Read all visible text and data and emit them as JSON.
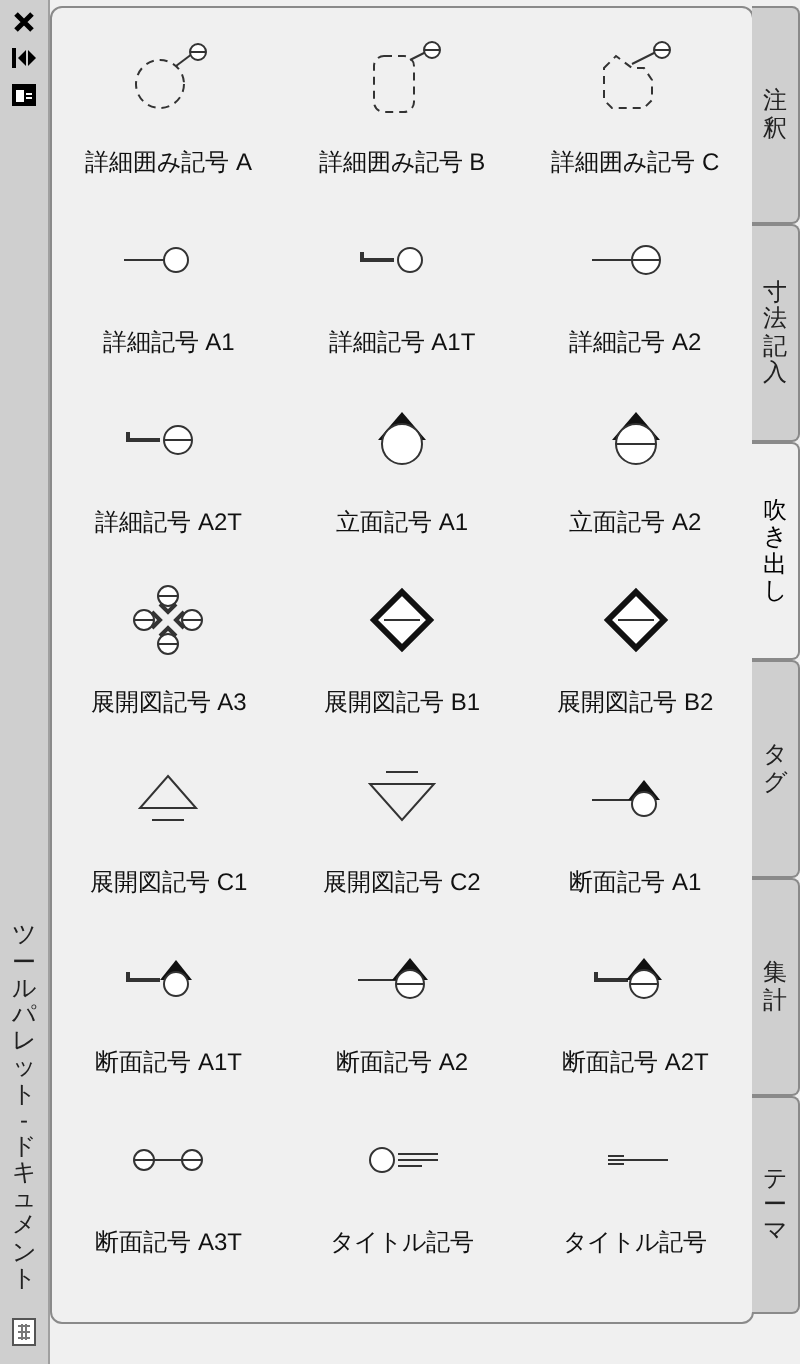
{
  "palette_title": "ツールパレット - ドキュメント",
  "tabs": [
    {
      "label": "注釈",
      "selected": false
    },
    {
      "label": "寸法記入",
      "selected": false
    },
    {
      "label": "吹き出し",
      "selected": true
    },
    {
      "label": "タグ",
      "selected": false
    },
    {
      "label": "集計",
      "selected": false
    },
    {
      "label": "テーマ",
      "selected": false
    }
  ],
  "tools": [
    {
      "label": "詳細囲み記号 A",
      "kind": "circle_callout"
    },
    {
      "label": "詳細囲み記号 B",
      "kind": "rounded_callout"
    },
    {
      "label": "詳細囲み記号 C",
      "kind": "cloud_callout"
    },
    {
      "label": "詳細記号 A1",
      "kind": "detail"
    },
    {
      "label": "詳細記号 A1T",
      "kind": "detail_tail"
    },
    {
      "label": "詳細記号 A2",
      "kind": "detail_split"
    },
    {
      "label": "詳細記号 A2T",
      "kind": "detail_split_tail"
    },
    {
      "label": "立面記号 A1",
      "kind": "elevation"
    },
    {
      "label": "立面記号 A2",
      "kind": "elevation_split"
    },
    {
      "label": "展開図記号 A3",
      "kind": "interior_four"
    },
    {
      "label": "展開図記号 B1",
      "kind": "interior_diamond"
    },
    {
      "label": "展開図記号 B2",
      "kind": "interior_diamond"
    },
    {
      "label": "展開図記号 C1",
      "kind": "triangle_up"
    },
    {
      "label": "展開図記号 C2",
      "kind": "triangle_down"
    },
    {
      "label": "断面記号 A1",
      "kind": "section"
    },
    {
      "label": "断面記号 A1T",
      "kind": "section_tail"
    },
    {
      "label": "断面記号 A2",
      "kind": "section_split"
    },
    {
      "label": "断面記号 A2T",
      "kind": "section_split_tail"
    },
    {
      "label": "断面記号 A3T",
      "kind": "section_pair"
    },
    {
      "label": "タイトル記号",
      "kind": "title_circle"
    },
    {
      "label": "タイトル記号",
      "kind": "title_line"
    }
  ]
}
